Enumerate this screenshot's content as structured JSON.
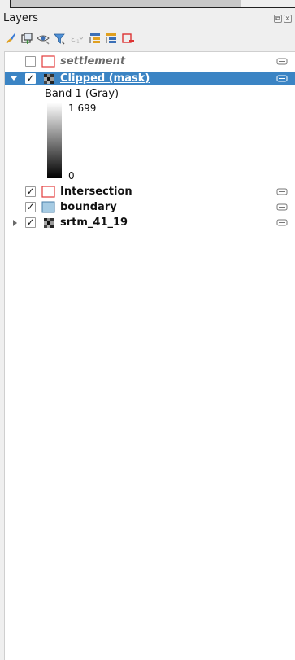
{
  "panel": {
    "title": "Layers"
  },
  "toolbar": {
    "buttons": [
      "style-manager",
      "add-group",
      "manage-visibility",
      "filter-legend",
      "filter-expression",
      "expand-all",
      "collapse-all",
      "remove-layer"
    ]
  },
  "layers": [
    {
      "name": "settlement",
      "checked": false,
      "expanded": null,
      "style": "italic",
      "symbol": "polygon-red-outline",
      "selected": false
    },
    {
      "name": "Clipped (mask)",
      "checked": true,
      "expanded": true,
      "style": "bold",
      "symbol": "raster",
      "selected": true
    },
    {
      "name": "Intersection",
      "checked": true,
      "expanded": null,
      "style": "bold",
      "symbol": "polygon-red-outline",
      "selected": false
    },
    {
      "name": "boundary",
      "checked": true,
      "expanded": null,
      "style": "bold",
      "symbol": "polygon-blue-fill",
      "selected": false
    },
    {
      "name": "srtm_41_19",
      "checked": true,
      "expanded": false,
      "style": "bold",
      "symbol": "raster",
      "selected": false
    }
  ],
  "legend": {
    "band": "Band 1 (Gray)",
    "max": "1 699",
    "min": "0"
  },
  "colors": {
    "selection": "#3b84c4",
    "red_outline": "#e23b3b",
    "blue_fill": "#a6cbe3"
  }
}
